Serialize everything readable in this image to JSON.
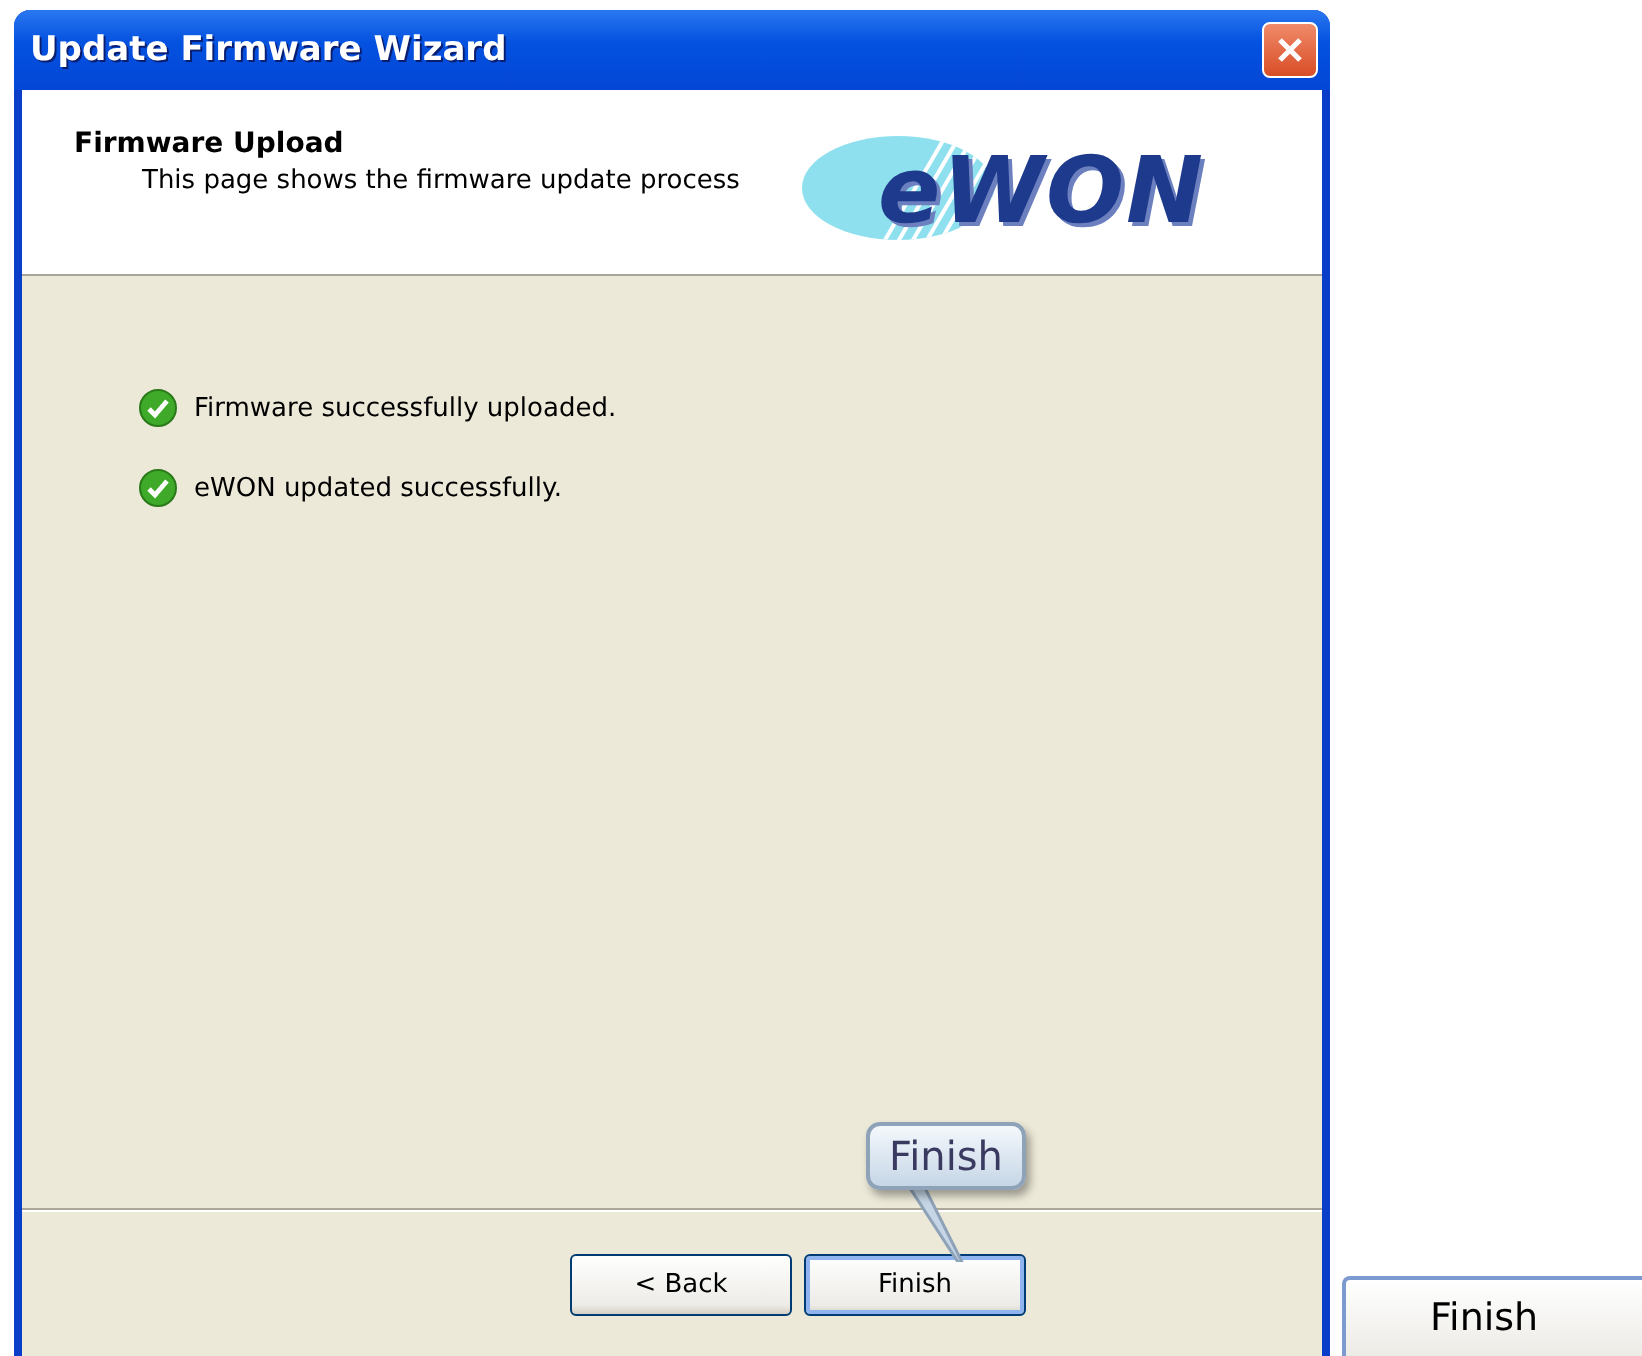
{
  "window": {
    "title": "Update Firmware Wizard"
  },
  "header": {
    "title": "Firmware Upload",
    "subtitle": "This page shows the firmware update process",
    "logo": "eWON"
  },
  "messages": [
    {
      "text": "Firmware successfully uploaded.",
      "kind": "success"
    },
    {
      "text": "eWON updated successfully.",
      "kind": "success"
    }
  ],
  "callout": {
    "text": "Finish"
  },
  "buttons": [
    {
      "label": "< Back",
      "focused": false
    },
    {
      "label": "Finish",
      "focused": true
    }
  ],
  "enlarged_button": {
    "label": "Finish"
  }
}
